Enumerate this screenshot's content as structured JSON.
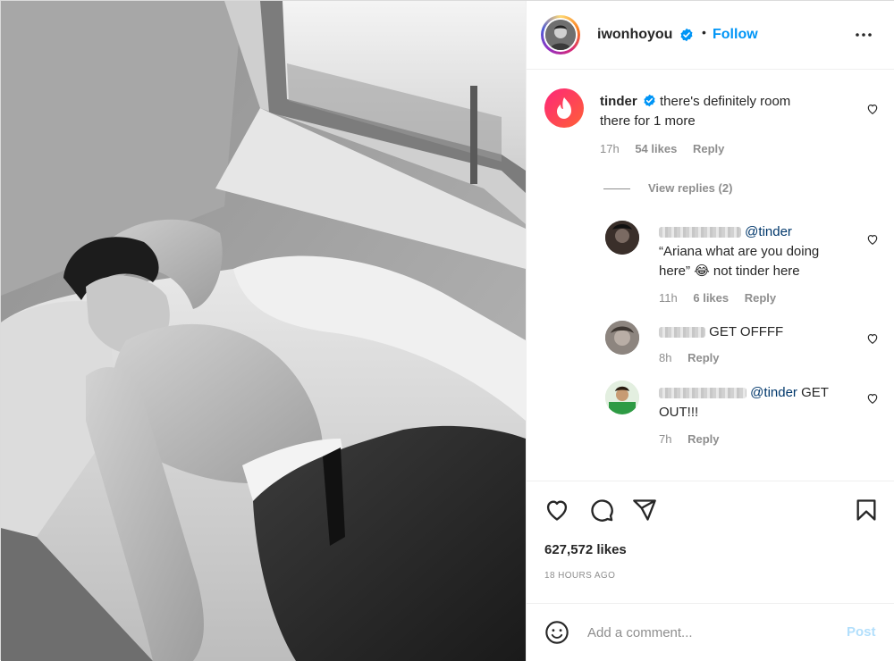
{
  "post": {
    "username": "iwonhoyou",
    "follow_label": "Follow",
    "separator": "•"
  },
  "comments": [
    {
      "user": "tinder",
      "verified": true,
      "text": "there's definitely room there for 1 more",
      "line1": "there's definitely room",
      "line2": "there for 1 more",
      "time": "17h",
      "likes": "54 likes",
      "reply_label": "Reply",
      "view_replies": "View replies (2)"
    },
    {
      "mention": "@tinder",
      "line1": "“Ariana what are you doing",
      "line2": "here”",
      "emoji": "😂",
      "line2_rest": " not tinder here",
      "time": "11h",
      "likes": "6 likes",
      "reply_label": "Reply"
    },
    {
      "text": "GET OFFFF",
      "time": "8h",
      "reply_label": "Reply"
    },
    {
      "mention": "@tinder",
      "text_after": " GET",
      "line2": "OUT!!!",
      "time": "7h",
      "reply_label": "Reply"
    }
  ],
  "stats": {
    "likes": "627,572 likes",
    "time": "18 HOURS AGO"
  },
  "composer": {
    "placeholder": "Add a comment...",
    "post_label": "Post"
  },
  "colors": {
    "link_blue": "#0095f6",
    "mention_blue": "#00376b",
    "muted": "#8e8e8e",
    "post_disabled": "#b2dffc",
    "tinder_gradient_start": "#fd267a",
    "tinder_gradient_end": "#ff6036"
  },
  "icons": {
    "header": [
      "verified-badge-icon",
      "more-options-icon"
    ],
    "comment": [
      "heart-outline-icon"
    ],
    "actions": [
      "like-icon",
      "comment-icon",
      "share-icon",
      "save-icon"
    ],
    "composer": [
      "emoji-icon"
    ]
  }
}
